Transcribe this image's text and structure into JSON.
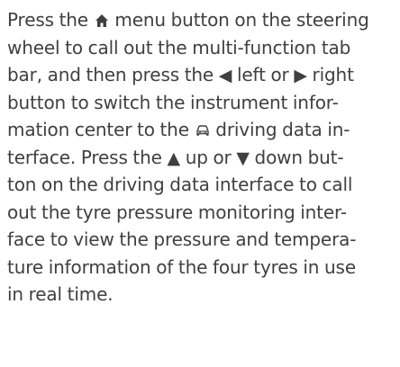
{
  "paragraph": {
    "l1": {
      "a": "Press the ",
      "icon": "⌂",
      "b": " menu button on the steering"
    },
    "l2": "wheel to call out the multi-function tab",
    "l3": {
      "a": "bar, and then press the ",
      "icon1": "◀",
      "b": " left or ",
      "icon2": "▶",
      "c": " right"
    },
    "l4": "button to switch the instrument infor-",
    "l5": {
      "a": "mation center to the ",
      "b": " driving data in-"
    },
    "l6": {
      "a": "terface. Press the ",
      "icon1": "▲",
      "b": " up or ",
      "icon2": "▼",
      "c": " down but-"
    },
    "l7": "ton on the driving data interface to call",
    "l8": "out the tyre pressure monitoring inter-",
    "l9": "face to view the pressure and tempera-",
    "l10": "ture information of the four tyres in use",
    "l11": "in real time."
  },
  "icons": {
    "menu": "home-icon",
    "left": "left-arrow-icon",
    "right": "right-arrow-icon",
    "driving": "car-icon",
    "up": "up-arrow-icon",
    "down": "down-arrow-icon"
  },
  "colors": {
    "text": "#404040",
    "background": "#ffffff"
  }
}
